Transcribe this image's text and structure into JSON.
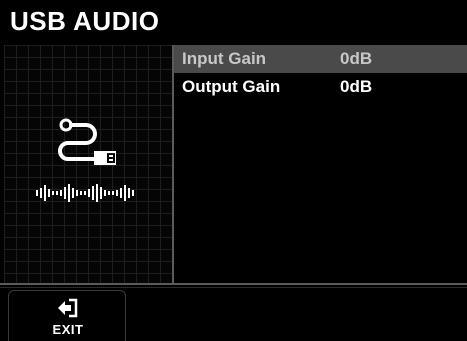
{
  "header": {
    "title": "USB AUDIO"
  },
  "icons": {
    "device": "usb-cable-icon",
    "waveform": "audio-waveform-icon",
    "exit": "exit-arrow-icon"
  },
  "menu": {
    "items": [
      {
        "label": "Input Gain",
        "value": "0dB",
        "selected": true
      },
      {
        "label": "Output Gain",
        "value": "0dB",
        "selected": false
      }
    ]
  },
  "footer": {
    "exit_label": "EXIT"
  },
  "colors": {
    "background": "#000000",
    "selected_row": "#4a4a4a",
    "grid": "#1e1e1e",
    "divider": "#5a5a5a",
    "text": "#ffffff"
  }
}
